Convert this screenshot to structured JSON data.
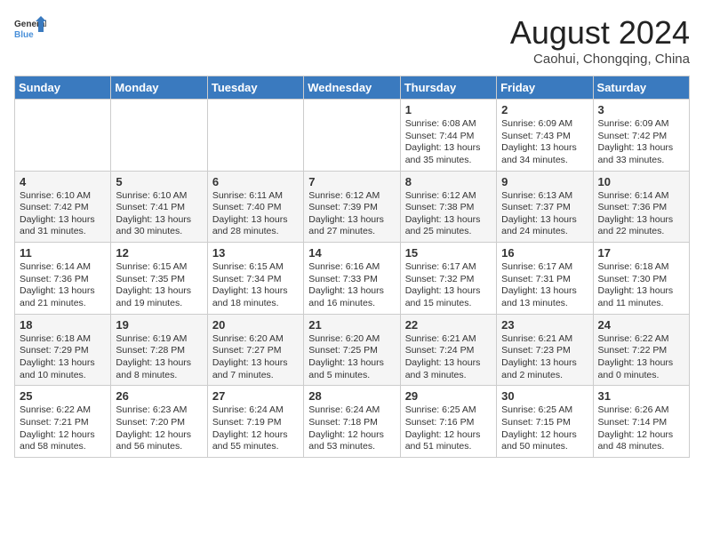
{
  "header": {
    "logo_general": "General",
    "logo_blue": "Blue",
    "month_title": "August 2024",
    "location": "Caohui, Chongqing, China"
  },
  "days_of_week": [
    "Sunday",
    "Monday",
    "Tuesday",
    "Wednesday",
    "Thursday",
    "Friday",
    "Saturday"
  ],
  "weeks": [
    [
      {
        "day": "",
        "info": ""
      },
      {
        "day": "",
        "info": ""
      },
      {
        "day": "",
        "info": ""
      },
      {
        "day": "",
        "info": ""
      },
      {
        "day": "1",
        "info": "Sunrise: 6:08 AM\nSunset: 7:44 PM\nDaylight: 13 hours\nand 35 minutes."
      },
      {
        "day": "2",
        "info": "Sunrise: 6:09 AM\nSunset: 7:43 PM\nDaylight: 13 hours\nand 34 minutes."
      },
      {
        "day": "3",
        "info": "Sunrise: 6:09 AM\nSunset: 7:42 PM\nDaylight: 13 hours\nand 33 minutes."
      }
    ],
    [
      {
        "day": "4",
        "info": "Sunrise: 6:10 AM\nSunset: 7:42 PM\nDaylight: 13 hours\nand 31 minutes."
      },
      {
        "day": "5",
        "info": "Sunrise: 6:10 AM\nSunset: 7:41 PM\nDaylight: 13 hours\nand 30 minutes."
      },
      {
        "day": "6",
        "info": "Sunrise: 6:11 AM\nSunset: 7:40 PM\nDaylight: 13 hours\nand 28 minutes."
      },
      {
        "day": "7",
        "info": "Sunrise: 6:12 AM\nSunset: 7:39 PM\nDaylight: 13 hours\nand 27 minutes."
      },
      {
        "day": "8",
        "info": "Sunrise: 6:12 AM\nSunset: 7:38 PM\nDaylight: 13 hours\nand 25 minutes."
      },
      {
        "day": "9",
        "info": "Sunrise: 6:13 AM\nSunset: 7:37 PM\nDaylight: 13 hours\nand 24 minutes."
      },
      {
        "day": "10",
        "info": "Sunrise: 6:14 AM\nSunset: 7:36 PM\nDaylight: 13 hours\nand 22 minutes."
      }
    ],
    [
      {
        "day": "11",
        "info": "Sunrise: 6:14 AM\nSunset: 7:36 PM\nDaylight: 13 hours\nand 21 minutes."
      },
      {
        "day": "12",
        "info": "Sunrise: 6:15 AM\nSunset: 7:35 PM\nDaylight: 13 hours\nand 19 minutes."
      },
      {
        "day": "13",
        "info": "Sunrise: 6:15 AM\nSunset: 7:34 PM\nDaylight: 13 hours\nand 18 minutes."
      },
      {
        "day": "14",
        "info": "Sunrise: 6:16 AM\nSunset: 7:33 PM\nDaylight: 13 hours\nand 16 minutes."
      },
      {
        "day": "15",
        "info": "Sunrise: 6:17 AM\nSunset: 7:32 PM\nDaylight: 13 hours\nand 15 minutes."
      },
      {
        "day": "16",
        "info": "Sunrise: 6:17 AM\nSunset: 7:31 PM\nDaylight: 13 hours\nand 13 minutes."
      },
      {
        "day": "17",
        "info": "Sunrise: 6:18 AM\nSunset: 7:30 PM\nDaylight: 13 hours\nand 11 minutes."
      }
    ],
    [
      {
        "day": "18",
        "info": "Sunrise: 6:18 AM\nSunset: 7:29 PM\nDaylight: 13 hours\nand 10 minutes."
      },
      {
        "day": "19",
        "info": "Sunrise: 6:19 AM\nSunset: 7:28 PM\nDaylight: 13 hours\nand 8 minutes."
      },
      {
        "day": "20",
        "info": "Sunrise: 6:20 AM\nSunset: 7:27 PM\nDaylight: 13 hours\nand 7 minutes."
      },
      {
        "day": "21",
        "info": "Sunrise: 6:20 AM\nSunset: 7:25 PM\nDaylight: 13 hours\nand 5 minutes."
      },
      {
        "day": "22",
        "info": "Sunrise: 6:21 AM\nSunset: 7:24 PM\nDaylight: 13 hours\nand 3 minutes."
      },
      {
        "day": "23",
        "info": "Sunrise: 6:21 AM\nSunset: 7:23 PM\nDaylight: 13 hours\nand 2 minutes."
      },
      {
        "day": "24",
        "info": "Sunrise: 6:22 AM\nSunset: 7:22 PM\nDaylight: 13 hours\nand 0 minutes."
      }
    ],
    [
      {
        "day": "25",
        "info": "Sunrise: 6:22 AM\nSunset: 7:21 PM\nDaylight: 12 hours\nand 58 minutes."
      },
      {
        "day": "26",
        "info": "Sunrise: 6:23 AM\nSunset: 7:20 PM\nDaylight: 12 hours\nand 56 minutes."
      },
      {
        "day": "27",
        "info": "Sunrise: 6:24 AM\nSunset: 7:19 PM\nDaylight: 12 hours\nand 55 minutes."
      },
      {
        "day": "28",
        "info": "Sunrise: 6:24 AM\nSunset: 7:18 PM\nDaylight: 12 hours\nand 53 minutes."
      },
      {
        "day": "29",
        "info": "Sunrise: 6:25 AM\nSunset: 7:16 PM\nDaylight: 12 hours\nand 51 minutes."
      },
      {
        "day": "30",
        "info": "Sunrise: 6:25 AM\nSunset: 7:15 PM\nDaylight: 12 hours\nand 50 minutes."
      },
      {
        "day": "31",
        "info": "Sunrise: 6:26 AM\nSunset: 7:14 PM\nDaylight: 12 hours\nand 48 minutes."
      }
    ]
  ]
}
